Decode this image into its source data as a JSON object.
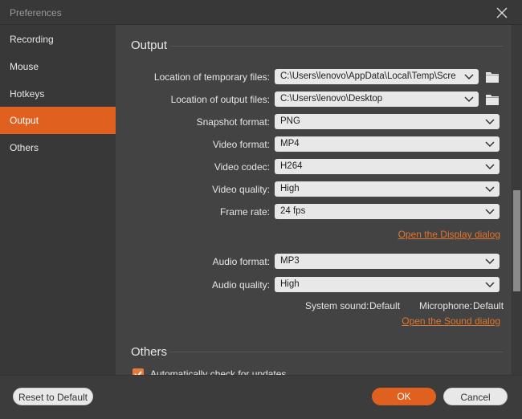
{
  "window": {
    "title": "Preferences",
    "close_icon": "close-x-icon"
  },
  "sidebar": {
    "items": [
      {
        "label": "Recording",
        "active": false
      },
      {
        "label": "Mouse",
        "active": false
      },
      {
        "label": "Hotkeys",
        "active": false
      },
      {
        "label": "Output",
        "active": true
      },
      {
        "label": "Others",
        "active": false
      }
    ]
  },
  "output": {
    "section_title": "Output",
    "temp_location": {
      "label": "Location of temporary files:",
      "value": "C:\\Users\\lenovo\\AppData\\Local\\Temp\\Screen"
    },
    "output_location": {
      "label": "Location of output files:",
      "value": "C:\\Users\\lenovo\\Desktop"
    },
    "snapshot_format": {
      "label": "Snapshot format:",
      "value": "PNG"
    },
    "video_format": {
      "label": "Video format:",
      "value": "MP4"
    },
    "video_codec": {
      "label": "Video codec:",
      "value": "H264"
    },
    "video_quality": {
      "label": "Video quality:",
      "value": "High"
    },
    "frame_rate": {
      "label": "Frame rate:",
      "value": "24 fps"
    },
    "display_link": "Open the Display dialog",
    "audio_format": {
      "label": "Audio format:",
      "value": "MP3"
    },
    "audio_quality": {
      "label": "Audio quality:",
      "value": "High"
    },
    "system_sound": {
      "label": "System sound:",
      "value": "Default"
    },
    "microphone": {
      "label": "Microphone:",
      "value": "Default"
    },
    "sound_link": "Open the Sound dialog"
  },
  "others": {
    "section_title": "Others",
    "auto_update": {
      "label": "Automatically check for updates",
      "checked": true
    }
  },
  "footer": {
    "reset_label": "Reset to Default",
    "ok_label": "OK",
    "cancel_label": "Cancel"
  },
  "colors": {
    "accent": "#e0611f",
    "link": "#e0752e",
    "background": "#434343",
    "sidebar": "#383838"
  }
}
